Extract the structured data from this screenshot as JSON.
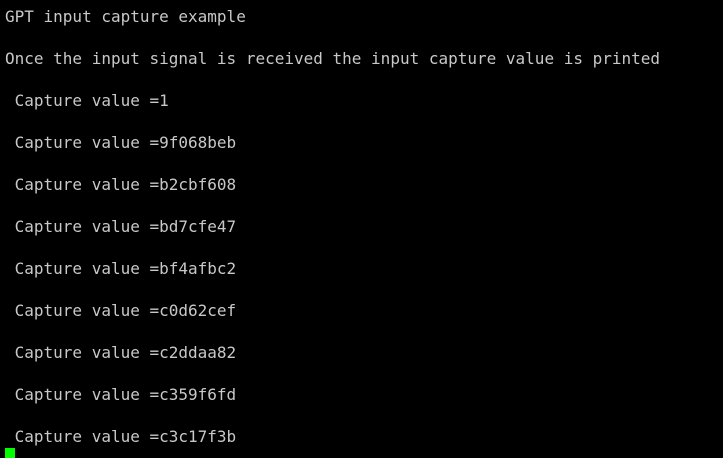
{
  "terminal": {
    "lines": [
      "GPT input capture example",
      "Once the input signal is received the input capture value is printed",
      " Capture value =1",
      " Capture value =9f068beb",
      " Capture value =b2cbf608",
      " Capture value =bd7cfe47",
      " Capture value =bf4afbc2",
      " Capture value =c0d62cef",
      " Capture value =c2ddaa82",
      " Capture value =c359f6fd",
      " Capture value =c3c17f3b"
    ],
    "colors": {
      "background": "#000000",
      "text": "#c8c8c8",
      "cursor": "#00ff00"
    }
  }
}
